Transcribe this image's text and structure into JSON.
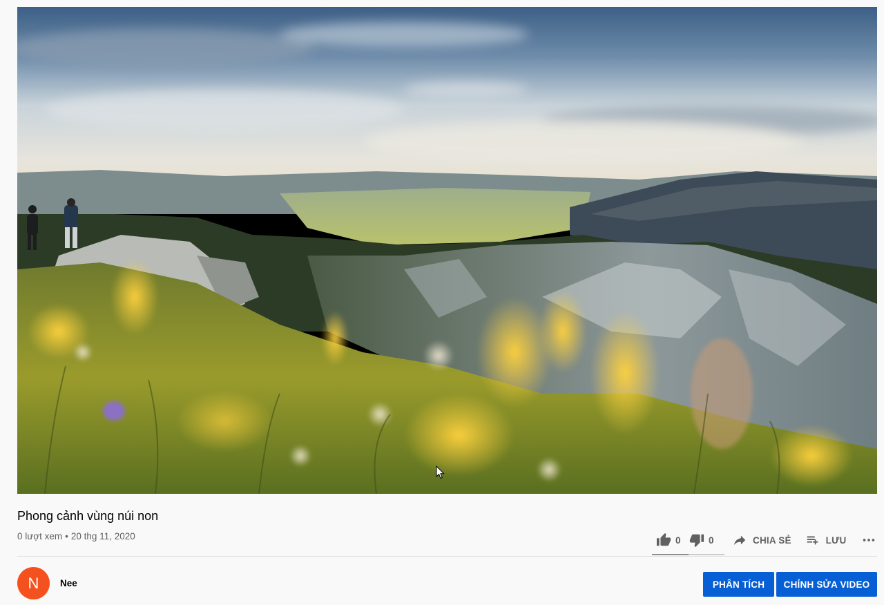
{
  "video": {
    "title": "Phong cảnh vùng núi non",
    "views": "0 lượt xem",
    "separator": "•",
    "date": "20 thg 11, 2020",
    "scene": "mountain-meadow-landscape"
  },
  "actions": {
    "like_count": "0",
    "dislike_count": "0",
    "share_label": "CHIA SẺ",
    "save_label": "LƯU",
    "sentiment_like_fraction": 0.5
  },
  "channel": {
    "avatar_letter": "N",
    "avatar_color": "#f4511e",
    "name": "Nee"
  },
  "buttons": {
    "analytics_label": "PHÂN TÍCH",
    "edit_label": "CHỈNH SỬA VIDEO",
    "accent": "#065fd4"
  },
  "icons": {
    "like": "thumb-up-icon",
    "dislike": "thumb-down-icon",
    "share": "share-arrow-icon",
    "save": "playlist-add-icon",
    "more": "more-horiz-icon",
    "cursor": "mouse-cursor-icon"
  }
}
